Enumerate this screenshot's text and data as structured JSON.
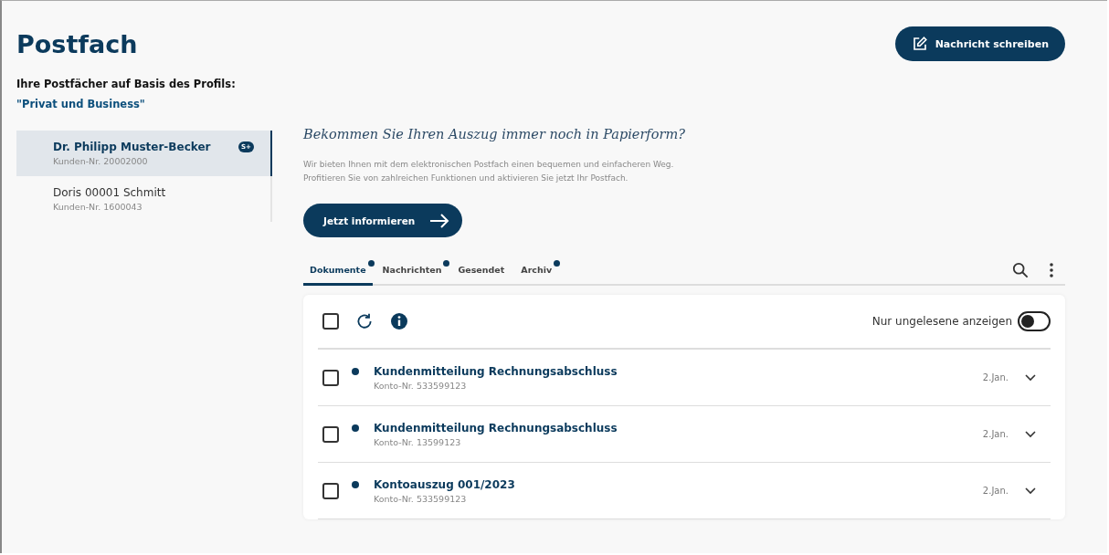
{
  "page": {
    "title": "Postfach",
    "compose_button": "Nachricht schreiben"
  },
  "profile": {
    "label": "Ihre Postfächer auf Basis des Profils:",
    "name": "\"Privat und Business\""
  },
  "mailboxes": [
    {
      "name": "Dr. Philipp Muster-Becker",
      "customer_no": "Kunden-Nr. 20002000",
      "badge": "S+",
      "selected": true
    },
    {
      "name": "Doris 00001 Schmitt",
      "customer_no": "Kunden-Nr. 1600043",
      "selected": false
    }
  ],
  "promo": {
    "heading": "Bekommen Sie Ihren Auszug immer noch in Papierform?",
    "lines": [
      "Wir bieten Ihnen mit dem elektronischen Postfach einen bequemen und einfacheren Weg.",
      "Profitieren Sie von zahlreichen Funktionen und aktivieren Sie jetzt Ihr Postfach."
    ],
    "button": "Jetzt informieren"
  },
  "tabs": [
    {
      "label": "Dokumente",
      "selected": true,
      "new": true
    },
    {
      "label": "Nachrichten",
      "selected": false,
      "new": true
    },
    {
      "label": "Gesendet",
      "selected": false,
      "new": false
    },
    {
      "label": "Archiv",
      "selected": false,
      "new": true
    }
  ],
  "toolbar": {
    "select_all_checked": false,
    "unread_only_label": "Nur ungelesene anzeigen",
    "unread_only_on": false
  },
  "messages": [
    {
      "subject": "Kundenmitteilung Rechnungsabschluss",
      "account": "Konto-Nr. 533599123",
      "date": "2.Jan.",
      "unread": true,
      "checked": false
    },
    {
      "subject": "Kundenmitteilung Rechnungsabschluss",
      "account": "Konto-Nr. 13599123",
      "date": "2.Jan.",
      "unread": true,
      "checked": false
    },
    {
      "subject": "Kontoauszug 001/2023",
      "account": "Konto-Nr. 533599123",
      "date": "2.Jan.",
      "unread": true,
      "checked": false
    }
  ]
}
